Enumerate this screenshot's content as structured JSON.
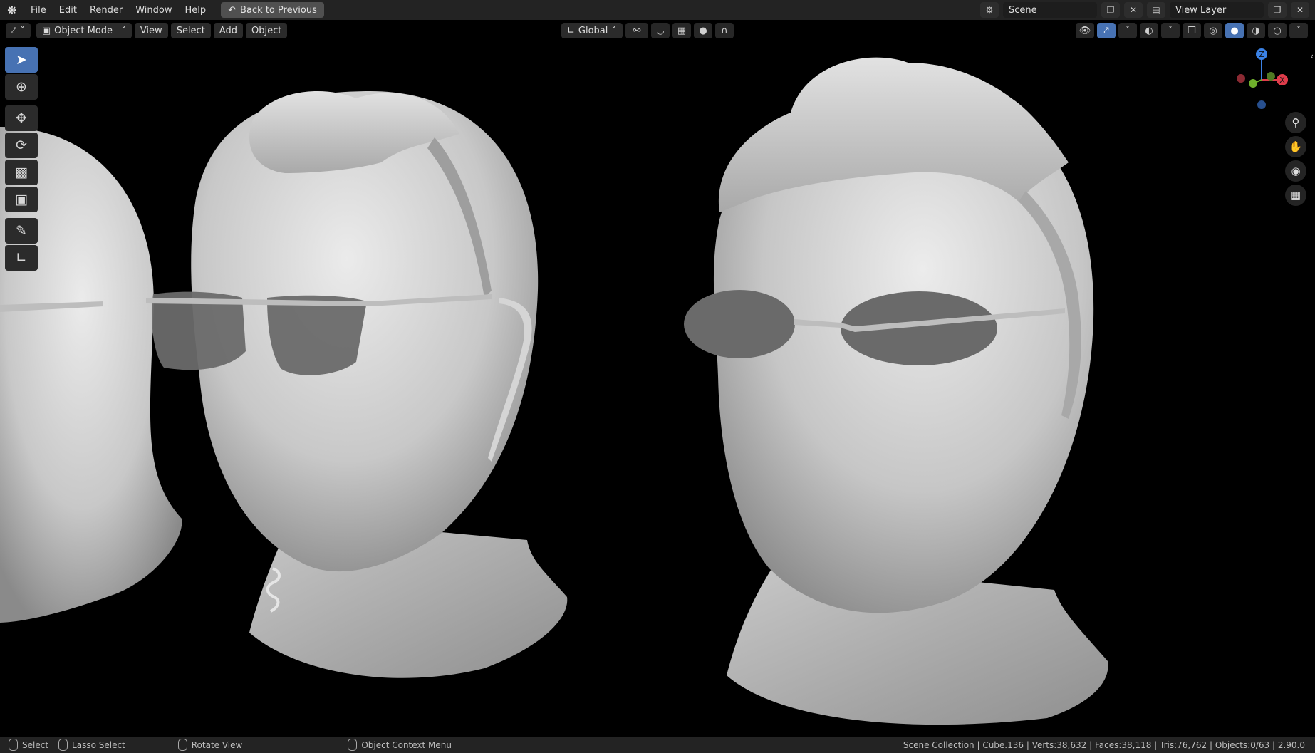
{
  "menubar": {
    "items": [
      "File",
      "Edit",
      "Render",
      "Window",
      "Help"
    ],
    "back_label": "Back to Previous",
    "scene_label": "Scene",
    "view_layer_label": "View Layer"
  },
  "header": {
    "mode_label": "Object Mode",
    "menu": [
      "View",
      "Select",
      "Add",
      "Object"
    ],
    "transform_orientation": "Global"
  },
  "statusbar": {
    "select": "Select",
    "lasso": "Lasso Select",
    "rotate": "Rotate View",
    "context_menu": "Object Context Menu",
    "stats": "Scene Collection | Cube.136 | Verts:38,632 | Faces:38,118 | Tris:76,762 | Objects:0/63 | 2.90.0"
  },
  "gizmo": {
    "z": "Z",
    "x": "X",
    "y": "Y"
  },
  "colors": {
    "accent": "#4772b3",
    "x_axis": "#e03c4b",
    "y_axis": "#6fb02c",
    "z_axis": "#3b82e6"
  }
}
